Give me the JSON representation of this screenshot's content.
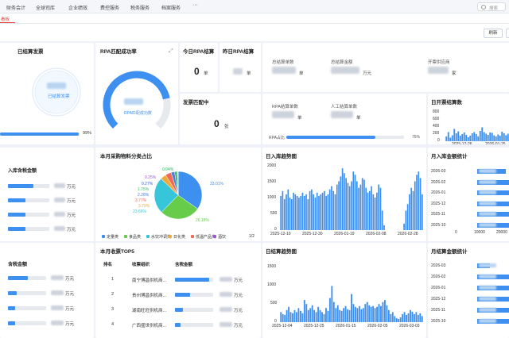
{
  "nav": [
    "财务会计",
    "全球司库",
    "企业绩效",
    "费控服务",
    "税务服务",
    "档案服务"
  ],
  "nav_more": "···",
  "search_placeholder": "搜索",
  "tab_label": "看板",
  "refresh_label": "刷新",
  "kpi": {
    "settled_title": "已结算发票",
    "settled_sub": "已结算发票",
    "settled_pct": "99%",
    "rpa_title": "RPA匹配成功率",
    "rpa_sub": "RPA匹配成功数",
    "today_title": "今日RPA结算",
    "today_value": "0",
    "today_unit": "单",
    "yesterday_title": "昨日RPA结算",
    "yesterday_unit": "单",
    "total_count_lbl": "总结算单数",
    "total_count_unit": "单",
    "total_amount_lbl": "总结算金额",
    "total_amount_unit": "万元",
    "invoice_co_lbl": "开票供应商",
    "invoice_co_unit": "家",
    "matching_title": "发票匹配中",
    "matching_value": "0",
    "matching_unit": "张",
    "rpa_count_lbl": "RPA结算单数",
    "rpa_count_unit": "单",
    "manual_count_lbl": "人工结算单数",
    "manual_count_unit": "单",
    "rpa_ratio_lbl": "RPA占比",
    "rpa_ratio_val": "76%",
    "rpa_ratio": 0.76,
    "settled_ratio": 0.99,
    "rpa_success_ratio": 0.79
  },
  "daily_invoice": {
    "title": "日开票结算数",
    "x": [
      "2025-12-26",
      "2026-01-25"
    ],
    "y_ticks": [
      "800",
      "600",
      "400",
      "200",
      "0"
    ]
  },
  "inbound_tax": {
    "title": "入库含税金额",
    "unit": "万元",
    "rows": [
      0.62,
      0.42,
      0.42,
      0.42
    ]
  },
  "category_pie": {
    "title": "本月采购物料分类占比",
    "slices": [
      {
        "label": "33.01%",
        "value": 33.01,
        "color": "#3d8ff0"
      },
      {
        "label": "26.18%",
        "value": 26.18,
        "color": "#67cc4a"
      },
      {
        "label": "23.66%",
        "value": 23.66,
        "color": "#36c5d9"
      },
      {
        "label": "3.79%",
        "value": 3.79,
        "color": "#f2a93b"
      },
      {
        "label": "3.77%",
        "value": 3.77,
        "color": "#ee6b55"
      },
      {
        "label": "2.28%",
        "value": 2.28,
        "color": "#4a7ee0"
      },
      {
        "label": "1.75%",
        "value": 1.75,
        "color": "#41b46c"
      },
      {
        "label": "0.27%",
        "value": 0.27,
        "color": "#3b5ad8"
      },
      {
        "label": "0.25%",
        "value": 0.25,
        "color": "#9b56d6"
      },
      {
        "label": "0.04%",
        "value": 0.04,
        "color": "#2fae60"
      }
    ],
    "legend": [
      {
        "name": "定量类",
        "color": "#3d8ff0"
      },
      {
        "name": "食品类",
        "color": "#67cc4a"
      },
      {
        "name": "水饮冲调类",
        "color": "#36c5d9"
      },
      {
        "name": "日化类",
        "color": "#f2a93b"
      },
      {
        "name": "低温产品类",
        "color": "#ee6b55"
      },
      {
        "name": "酒饮",
        "color": "#9b56d6"
      }
    ],
    "pager": "1/2"
  },
  "daily_inbound": {
    "title": "日入库趋势图",
    "y_ticks": [
      "2000",
      "1500",
      "1000",
      "500",
      "0"
    ],
    "x": [
      "2025-12-10",
      "2025-12-30",
      "2026-01-19",
      "2026-02-08",
      "2026-02-28"
    ]
  },
  "month_inbound": {
    "title": "月入库金额统计",
    "categories": [
      "2026-03",
      "2026-02",
      "2026-01",
      "2025-12",
      "2025-11",
      "2025-10"
    ],
    "values": [
      14500,
      25000,
      25000,
      25000,
      25000,
      25000
    ],
    "x_ticks": [
      "0",
      "10000",
      "20000"
    ]
  },
  "tax_amount": {
    "title": "含税金额",
    "unit": "万元",
    "rows": [
      0.52,
      0.22,
      0.18,
      0.18
    ]
  },
  "top5": {
    "title": "本月收票TOP5",
    "headers": [
      "排名",
      "收票组织",
      "含税金额"
    ],
    "rows": [
      {
        "rank": "1",
        "org": "南宁博昌供机商...",
        "bar": 0.9,
        "unit": "万元"
      },
      {
        "rank": "2",
        "org": "贵州博昌供机商...",
        "bar": 0.4,
        "unit": "万元"
      },
      {
        "rank": "3",
        "org": "湖南旺旺供机商...",
        "bar": 0.2,
        "unit": "万元"
      },
      {
        "rank": "4",
        "org": "广西盛世供机商...",
        "bar": 0.15,
        "unit": "万元"
      }
    ]
  },
  "daily_settle": {
    "title": "日结算趋势图",
    "y_ticks": [
      "1500",
      "1000",
      "500",
      "0"
    ],
    "x": [
      "2025-12-04",
      "2025-12-25",
      "2026-01-15",
      "2026-02-05",
      "2026-03-03"
    ]
  },
  "month_settle": {
    "title": "月结算金额统计",
    "categories": [
      "2026-03",
      "2026-02",
      "2026-01",
      "2025-12",
      "2025-11",
      "2025-10"
    ],
    "values": [
      0.25,
      1,
      1,
      1,
      1,
      1
    ]
  },
  "colors": {
    "accent": "#3d8ff0",
    "tab": "#e0463a",
    "track": "#e6e9ee"
  }
}
